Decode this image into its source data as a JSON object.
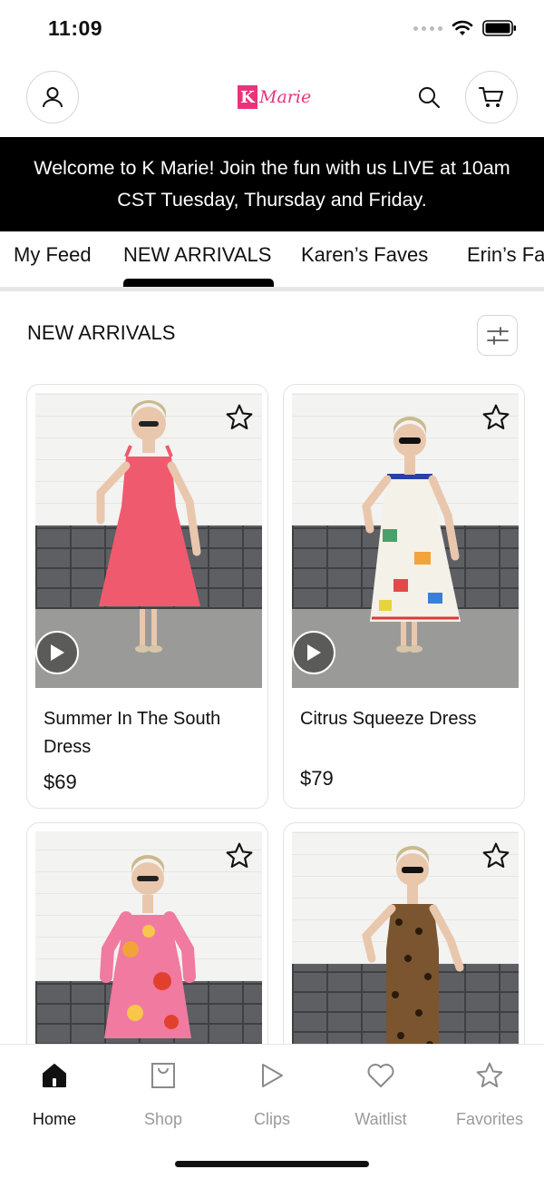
{
  "status_bar": {
    "time": "11:09",
    "icons": [
      "signal-dots",
      "wifi-icon",
      "battery-icon"
    ]
  },
  "header": {
    "logo_text": "Marie",
    "logo_letter": "K",
    "icons": [
      "user-icon",
      "search-icon",
      "cart-icon"
    ],
    "brand_color": "#e8347a"
  },
  "banner": {
    "text": "Welcome to K Marie! Join the fun with us LIVE at 10am CST Tuesday, Thursday and Friday."
  },
  "tabs": [
    {
      "label": "My Feed",
      "active": false
    },
    {
      "label": "NEW ARRIVALS",
      "active": true
    },
    {
      "label": "Karen’s Faves",
      "active": false
    },
    {
      "label": "Erin’s Faves",
      "active": false
    }
  ],
  "section": {
    "title": "NEW ARRIVALS",
    "filter_icon": "sliders-icon"
  },
  "products": [
    {
      "name": "Summer In The South Dress",
      "price": "$69",
      "has_video": true,
      "outfit_color": "#ef5a6f"
    },
    {
      "name": "Citrus Squeeze Dress",
      "price": "$79",
      "has_video": true,
      "outfit_color": "#f4f1e8"
    },
    {
      "name": "",
      "price": "",
      "has_video": false,
      "outfit_color": "#f07aa0"
    },
    {
      "name": "",
      "price": "",
      "has_video": false,
      "outfit_color": "#7a5530"
    }
  ],
  "bottom_nav": [
    {
      "label": "Home",
      "icon": "home-icon",
      "active": true
    },
    {
      "label": "Shop",
      "icon": "shopping-bag-icon",
      "active": false
    },
    {
      "label": "Clips",
      "icon": "play-icon",
      "active": false
    },
    {
      "label": "Waitlist",
      "icon": "heart-icon",
      "active": false
    },
    {
      "label": "Favorites",
      "icon": "star-icon",
      "active": false
    }
  ]
}
